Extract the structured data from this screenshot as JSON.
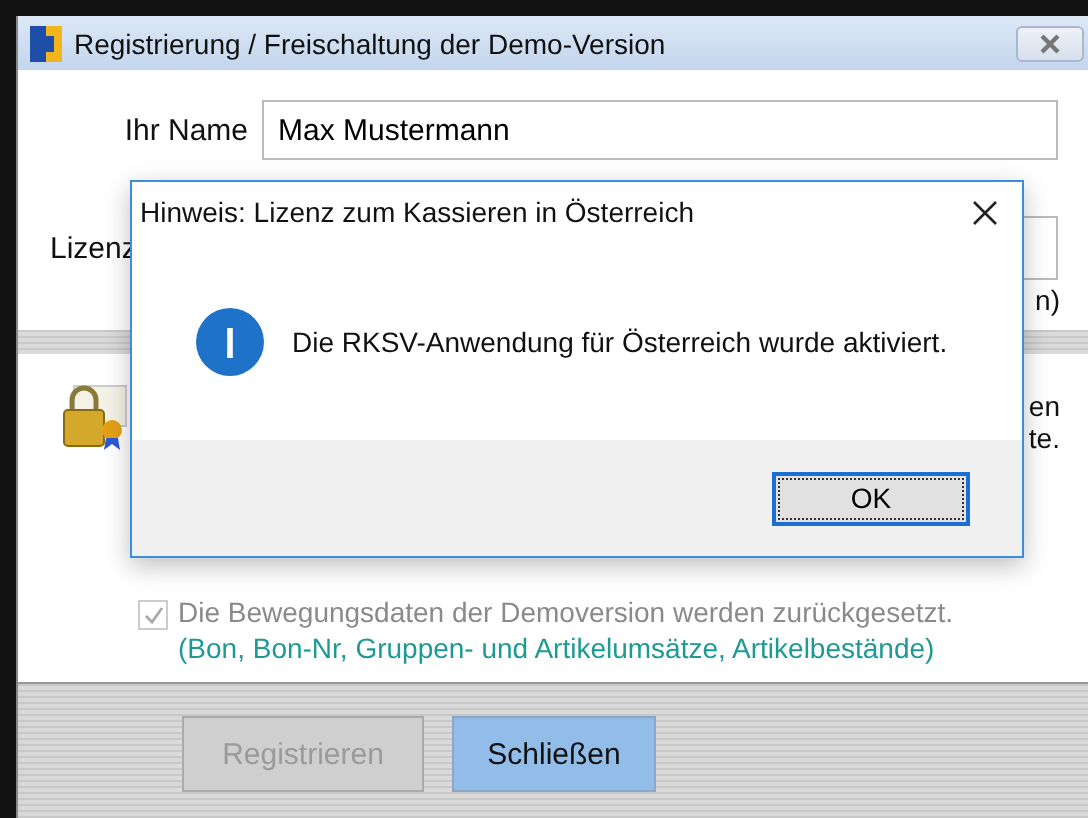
{
  "window": {
    "title": "Registrierung / Freischaltung der Demo-Version"
  },
  "name_field": {
    "label": "Ihr Name",
    "value": "Max Mustermann"
  },
  "license_row": {
    "label": "Lizenz",
    "note": "n)"
  },
  "info_text": {
    "line_1": "en",
    "line_2": "te."
  },
  "reset_option": {
    "label": "Die Bewegungsdaten der Demoversion werden zurückgesetzt.",
    "checked": true,
    "disabled": true,
    "note": "(Bon, Bon-Nr, Gruppen- und Artikelumsätze, Artikelbestände)"
  },
  "buttons": [
    {
      "label": "Registrieren",
      "disabled": true,
      "highlighted": false
    },
    {
      "label": "Schließen",
      "disabled": false,
      "highlighted": true
    }
  ],
  "dialog": {
    "title": "Hinweis: Lizenz zum Kassieren in Österreich",
    "message": "Die RKSV-Anwendung für Österreich wurde aktiviert.",
    "buttons": [
      "OK"
    ]
  }
}
